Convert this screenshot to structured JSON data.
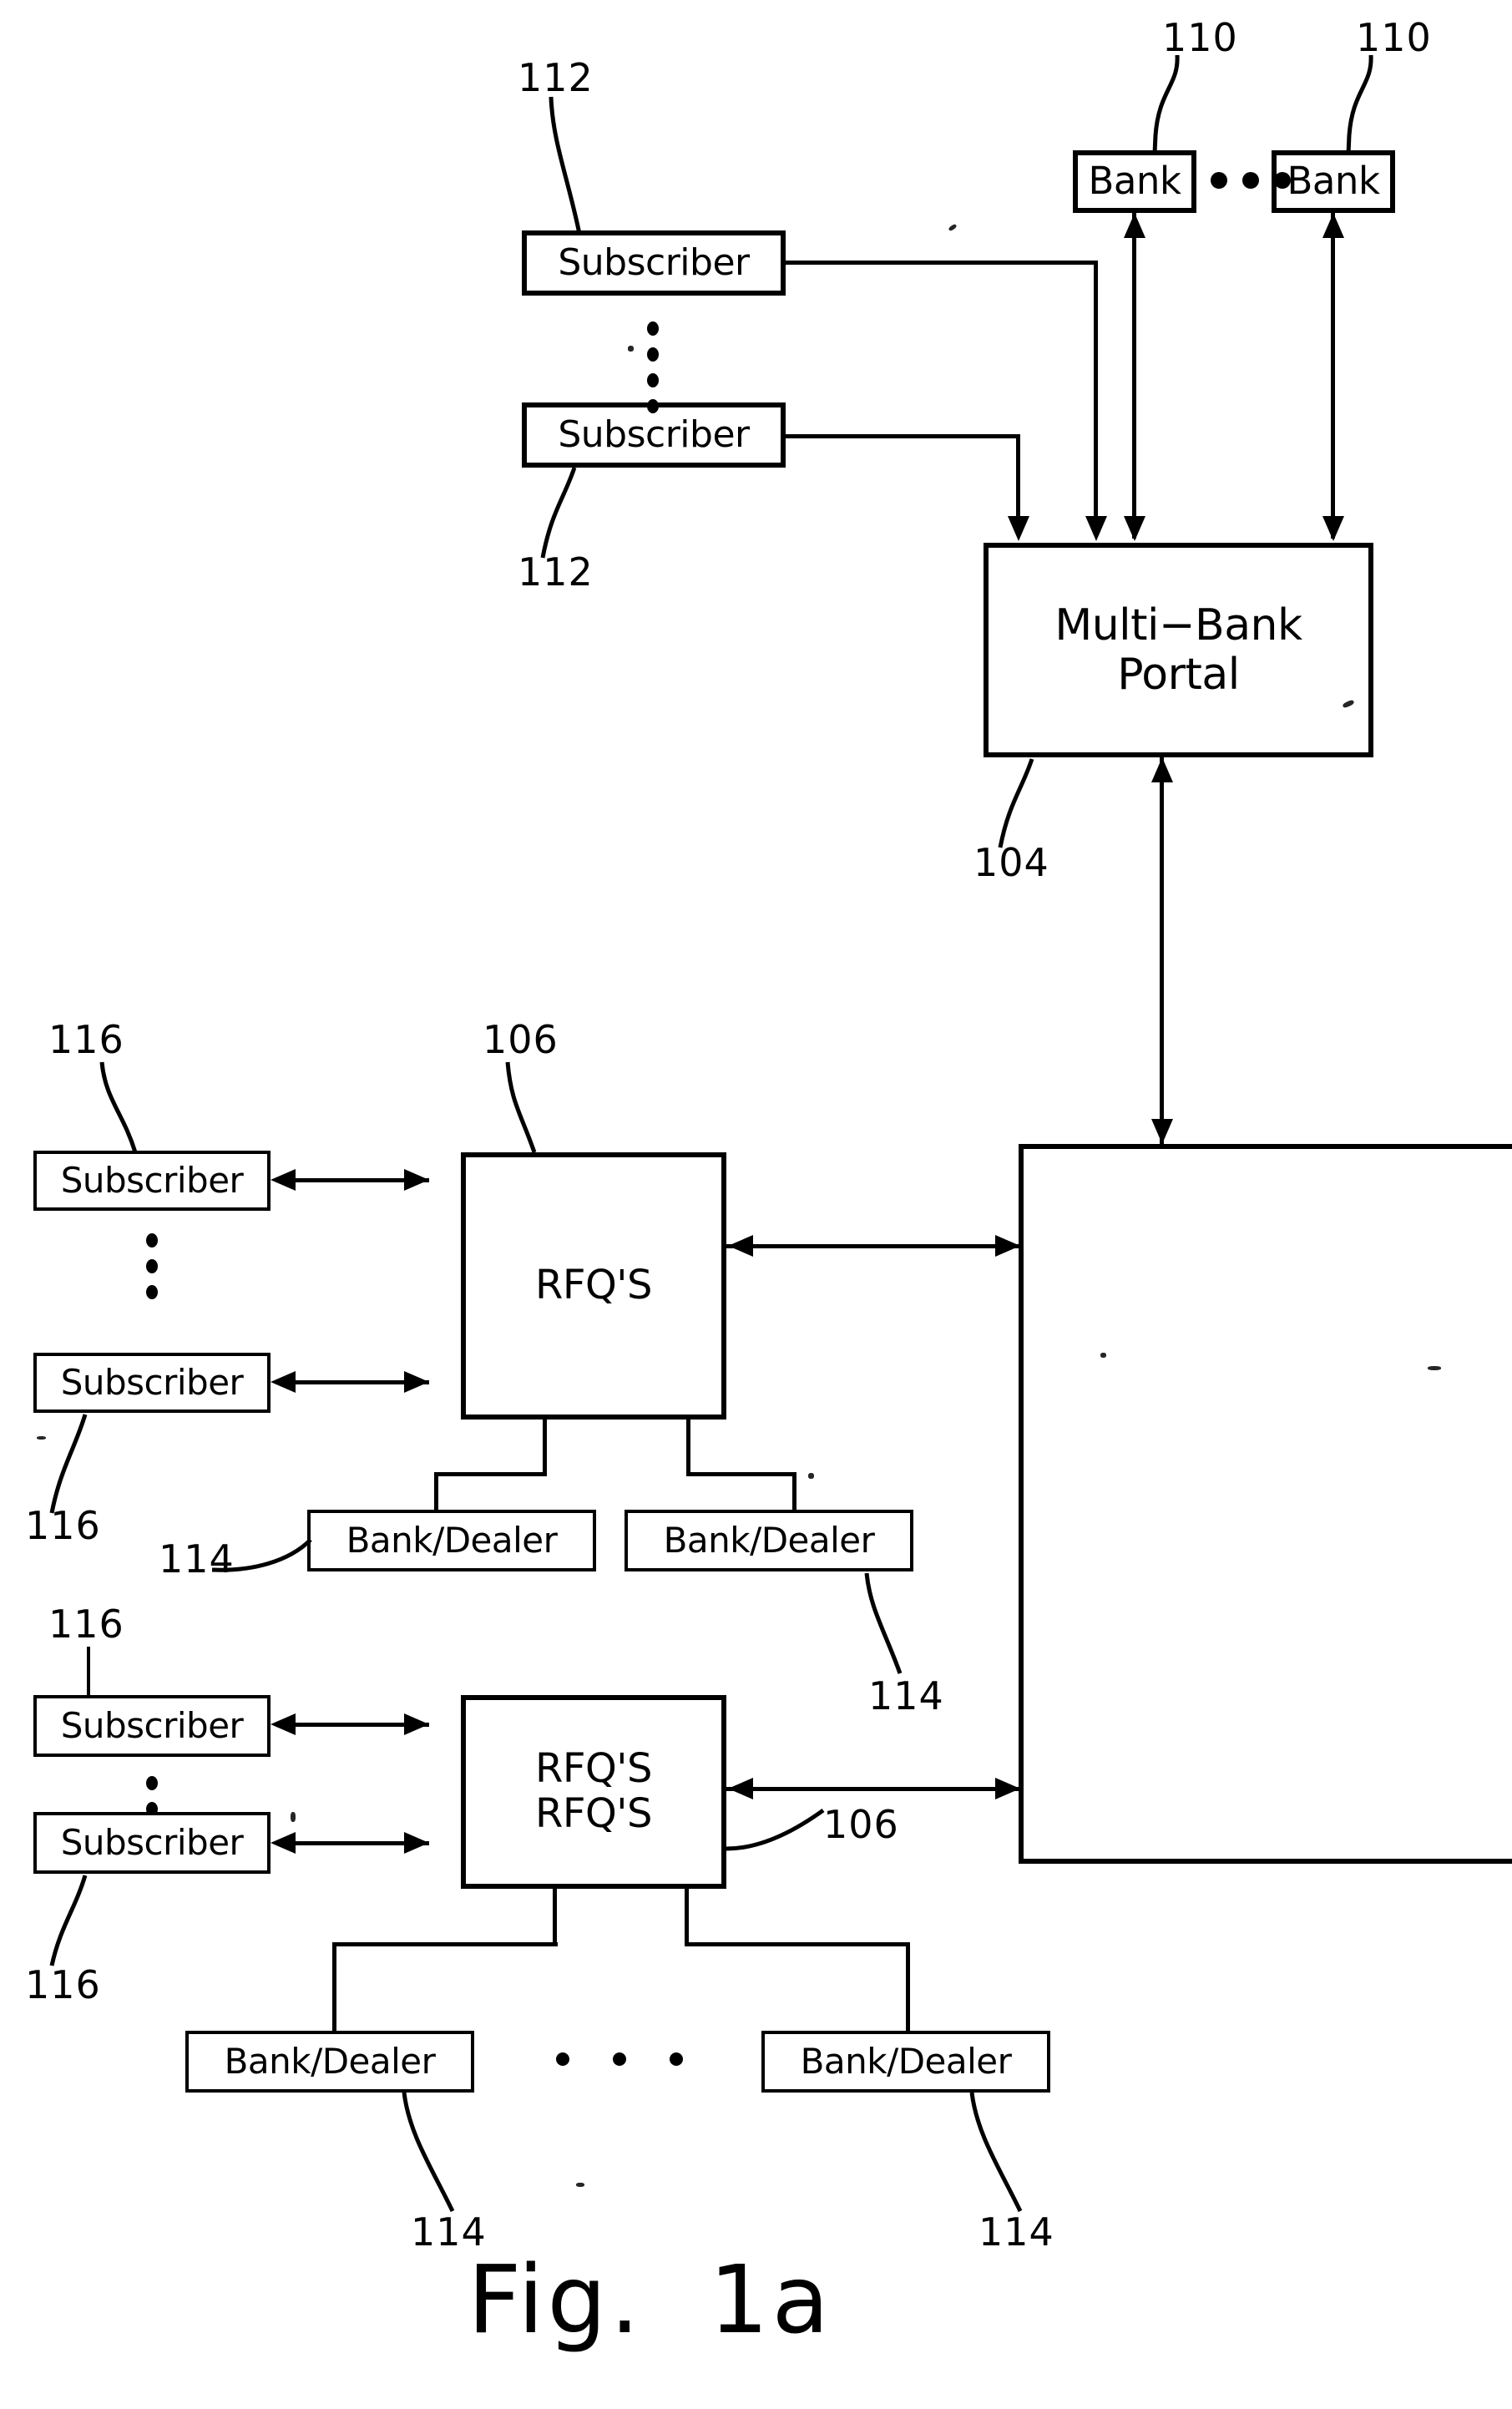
{
  "figure": {
    "caption": "Fig.  1a",
    "title": "Fig. 1a"
  },
  "nodes": {
    "bank_left": {
      "label": "Bank",
      "ref": "110"
    },
    "bank_right": {
      "label": "Bank",
      "ref": "110"
    },
    "subscriber_top_1": {
      "label": "Subscriber",
      "ref": "112"
    },
    "subscriber_top_2": {
      "label": "Subscriber",
      "ref": "112"
    },
    "multi_bank_portal": {
      "label": "Multi−Bank\nPortal",
      "ref": "104"
    },
    "rfqs_upper": {
      "label": "RFQ'S",
      "ref": "106"
    },
    "rfqs_lower": {
      "label": "RFQ'S\nRFQ'S",
      "ref": "106"
    },
    "subscriber_mid_1": {
      "label": "Subscriber",
      "ref": "116"
    },
    "subscriber_mid_2": {
      "label": "Subscriber",
      "ref": "116"
    },
    "subscriber_low_1": {
      "label": "Subscriber",
      "ref": "116"
    },
    "subscriber_low_2": {
      "label": "Subscriber",
      "ref": "116"
    },
    "bank_dealer_mid_1": {
      "label": "Bank/Dealer",
      "ref": "114"
    },
    "bank_dealer_mid_2": {
      "label": "Bank/Dealer",
      "ref": "114"
    },
    "bank_dealer_low_1": {
      "label": "Bank/Dealer",
      "ref": "114"
    },
    "bank_dealer_low_2": {
      "label": "Bank/Dealer",
      "ref": "114"
    },
    "right_panel": {
      "label": ""
    }
  },
  "reference_numerals": {
    "r110_left": "110",
    "r110_right": "110",
    "r112_top": "112",
    "r112_bottom": "112",
    "r104": "104",
    "r106_upper": "106",
    "r106_lower": "106",
    "r116_a": "116",
    "r116_b": "116",
    "r116_c": "116",
    "r116_d": "116",
    "r114_a": "114",
    "r114_b": "114",
    "r114_c": "114",
    "r114_d": "114"
  },
  "ellipsis": {
    "between_banks": "•••",
    "between_subscribers": "vertical-dots",
    "between_bank_dealers": "• • •"
  }
}
